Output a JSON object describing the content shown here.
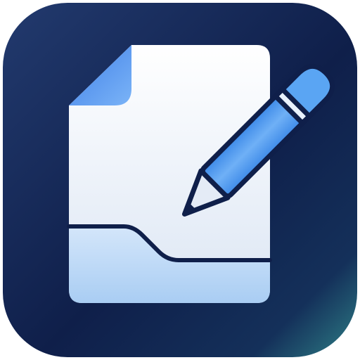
{
  "icon": {
    "name": "document-edit-app-icon",
    "depicts": [
      "document-icon",
      "pencil-icon"
    ]
  },
  "colors": {
    "background_top_left": "#223a6e",
    "background_mid": "#0f1f4a",
    "background_bottom_right": "#2e7f86",
    "paper_top": "#ffffff",
    "paper_bottom": "#dce6f4",
    "folded_corner": "#4d8ff2",
    "bottom_panel_top": "#d4e6fa",
    "bottom_panel_bottom": "#a9cdf3",
    "outline": "#0f1f4a",
    "pencil_body": "#4d9bf0",
    "pencil_body_light": "#8cc2fa",
    "pencil_tip_wood": "#e4ebf6"
  }
}
